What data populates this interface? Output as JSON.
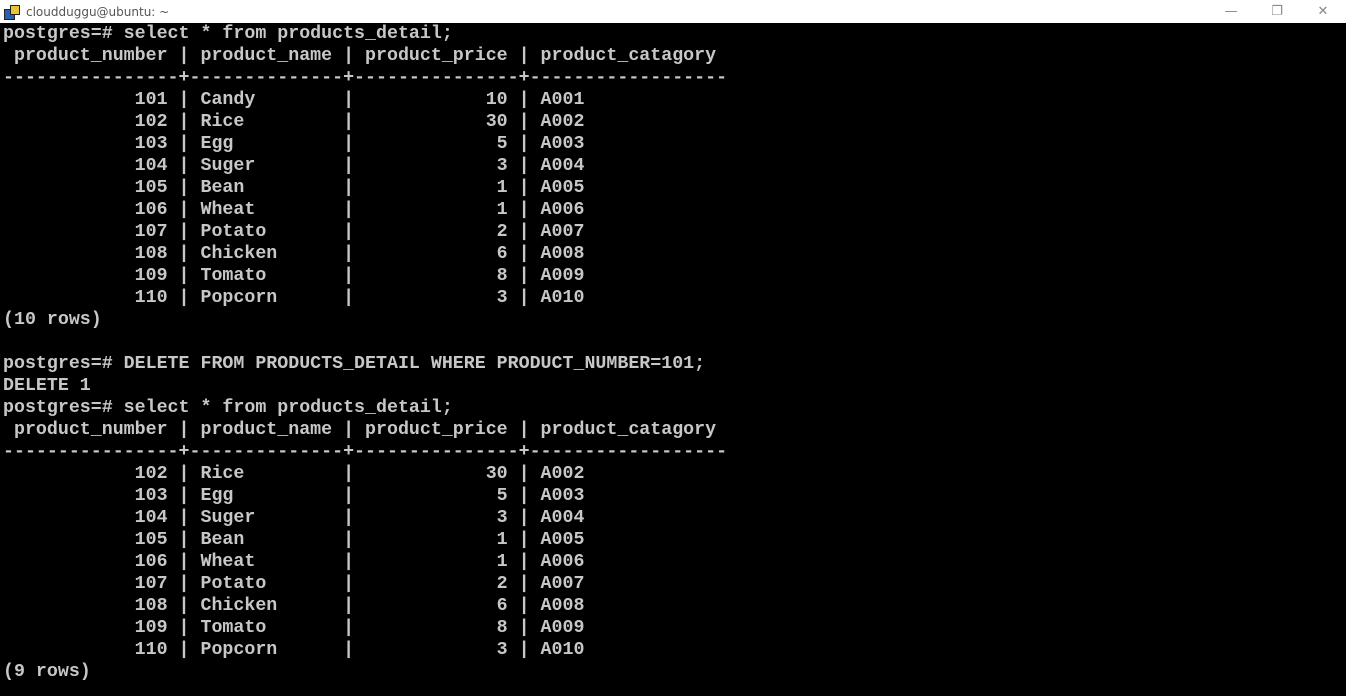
{
  "window": {
    "title": "cloudduggu@ubuntu: ~",
    "icon": "putty-icon",
    "controls": {
      "minimize": "—",
      "restore": "❐",
      "close": "✕"
    }
  },
  "terminal": {
    "lines": [
      "postgres=# select * from products_detail;",
      " product_number | product_name | product_price | product_catagory",
      "----------------+--------------+---------------+------------------",
      "            101 | Candy        |            10 | A001",
      "            102 | Rice         |            30 | A002",
      "            103 | Egg          |             5 | A003",
      "            104 | Suger        |             3 | A004",
      "            105 | Bean         |             1 | A005",
      "            106 | Wheat        |             1 | A006",
      "            107 | Potato       |             2 | A007",
      "            108 | Chicken      |             6 | A008",
      "            109 | Tomato       |             8 | A009",
      "            110 | Popcorn      |             3 | A010",
      "(10 rows)",
      "",
      "postgres=# DELETE FROM PRODUCTS_DETAIL WHERE PRODUCT_NUMBER=101;",
      "DELETE 1",
      "postgres=# select * from products_detail;",
      " product_number | product_name | product_price | product_catagory",
      "----------------+--------------+---------------+------------------",
      "            102 | Rice         |            30 | A002",
      "            103 | Egg          |             5 | A003",
      "            104 | Suger        |             3 | A004",
      "            105 | Bean         |             1 | A005",
      "            106 | Wheat        |             1 | A006",
      "            107 | Potato       |             2 | A007",
      "            108 | Chicken      |             6 | A008",
      "            109 | Tomato       |             8 | A009",
      "            110 | Popcorn      |             3 | A010",
      "(9 rows)"
    ]
  }
}
